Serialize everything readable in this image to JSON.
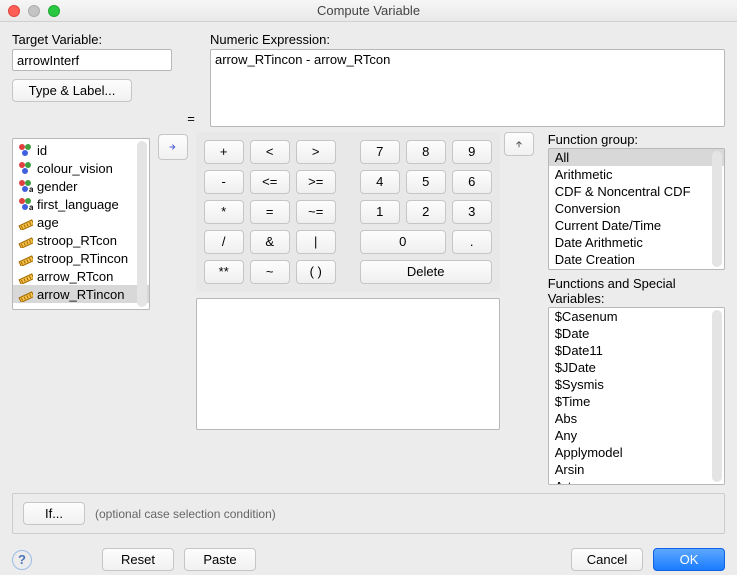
{
  "window": {
    "title": "Compute Variable"
  },
  "target": {
    "label": "Target Variable:",
    "value": "arrowInterf",
    "type_label_button": "Type & Label..."
  },
  "equals": "=",
  "expression": {
    "label": "Numeric Expression:",
    "value": "arrow_RTincon - arrow_RTcon"
  },
  "variables": [
    {
      "name": "id",
      "icon": "nominal"
    },
    {
      "name": "colour_vision",
      "icon": "nominal"
    },
    {
      "name": "gender",
      "icon": "string"
    },
    {
      "name": "first_language",
      "icon": "string"
    },
    {
      "name": "age",
      "icon": "scale"
    },
    {
      "name": "stroop_RTcon",
      "icon": "scale"
    },
    {
      "name": "stroop_RTincon",
      "icon": "scale"
    },
    {
      "name": "arrow_RTcon",
      "icon": "scale"
    },
    {
      "name": "arrow_RTincon",
      "icon": "scale",
      "selected": true
    }
  ],
  "keypad": {
    "r1": [
      "+",
      "<",
      ">",
      "7",
      "8",
      "9"
    ],
    "r2": [
      "-",
      "<=",
      ">=",
      "4",
      "5",
      "6"
    ],
    "r3": [
      "*",
      "=",
      "~=",
      "1",
      "2",
      "3"
    ],
    "r4": [
      "/",
      "&",
      "|",
      "0",
      "."
    ],
    "r5": [
      "**",
      "~",
      "( )",
      "Delete"
    ]
  },
  "function_group": {
    "label": "Function group:",
    "items": [
      "All",
      "Arithmetic",
      "CDF & Noncentral CDF",
      "Conversion",
      "Current Date/Time",
      "Date Arithmetic",
      "Date Creation"
    ],
    "selected": "All"
  },
  "functions": {
    "label": "Functions and Special Variables:",
    "items": [
      "$Casenum",
      "$Date",
      "$Date11",
      "$JDate",
      "$Sysmis",
      "$Time",
      "Abs",
      "Any",
      "Applymodel",
      "Arsin",
      "Artan"
    ]
  },
  "if_section": {
    "button": "If...",
    "text": "(optional case selection condition)"
  },
  "buttons": {
    "reset": "Reset",
    "paste": "Paste",
    "cancel": "Cancel",
    "ok": "OK"
  }
}
